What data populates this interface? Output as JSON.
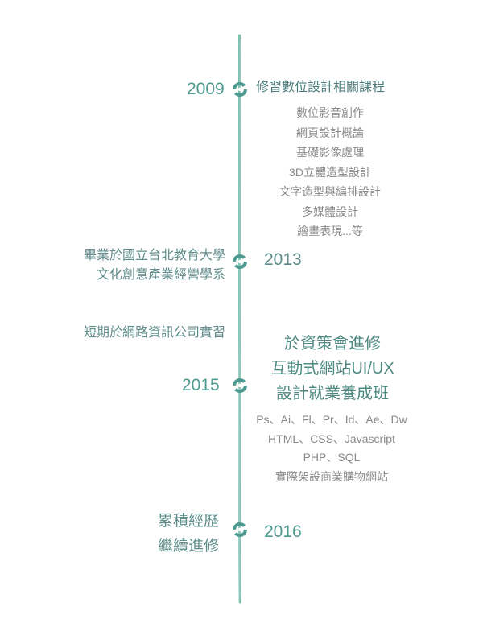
{
  "milestones": [
    {
      "year": "2009",
      "heading": "修習數位設計相關課程",
      "items": [
        "數位影音創作",
        "網頁設計概論",
        "基礎影像處理",
        "3D立體造型設計",
        "文字造型與編排設計",
        "多媒體設計",
        "繪畫表現...等"
      ]
    },
    {
      "year": "2013",
      "lines": [
        "畢業於國立台北教育大學",
        "文化創意產業經營學系"
      ]
    },
    {
      "year": "2015",
      "side_note": "短期於網路資訊公司實習",
      "heading_lines": [
        "於資策會進修",
        "互動式網站UI/UX",
        "設計就業養成班"
      ],
      "items": [
        "Ps、Ai、Fl、Pr、Id、Ae、Dw",
        "HTML、CSS、Javascript",
        "PHP、SQL",
        "實際架設商業購物網站"
      ]
    },
    {
      "year": "2016",
      "lines": [
        "累積經歷",
        "繼續進修"
      ]
    }
  ],
  "colors": {
    "line": "#7fbfb0",
    "accent": "#4e9a91",
    "heading": "#4b7b7b",
    "muted": "#8a8a8a"
  },
  "node_icon": "circular-arrows-icon"
}
